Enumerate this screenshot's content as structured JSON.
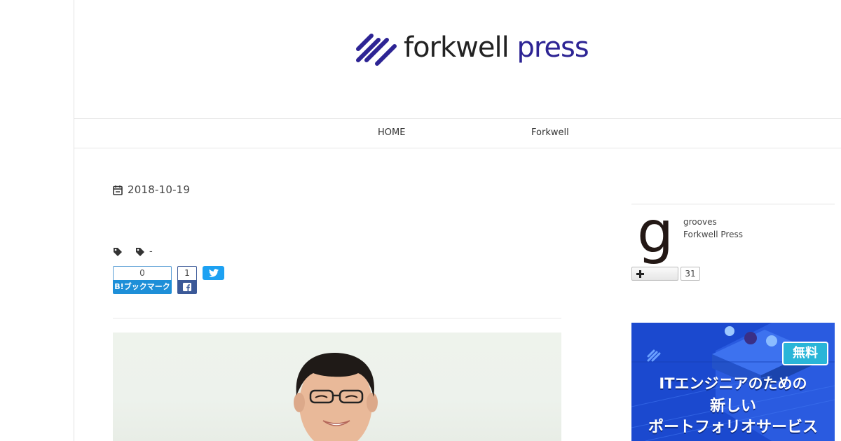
{
  "brand": {
    "word1": "forkwell",
    "word2": "press",
    "mark_color": "#2d2494",
    "logo_icon": "forkwell-stripes-logo"
  },
  "nav": {
    "items": [
      {
        "label": "HOME"
      },
      {
        "label": "Forkwell"
      }
    ]
  },
  "article": {
    "date": "2018-10-19",
    "date_icon": "calendar-icon",
    "tag_icon": "tag-icon",
    "tag_text": "-",
    "share": {
      "hatena_count": "0",
      "hatena_label": "B!ブックマーク",
      "hatena_color": "#1e8fd8",
      "facebook_count": "1",
      "facebook_color": "#3b5998",
      "twitter_color": "#1da1f2"
    }
  },
  "sidebar": {
    "avatar_letter": "g",
    "name": "grooves",
    "site": "Forkwell Press",
    "follow_count": "31",
    "ad": {
      "badge": "無料",
      "line1": "ITエンジニアのための",
      "line2": "新しい",
      "line3": "ポートフォリオサービス"
    }
  }
}
